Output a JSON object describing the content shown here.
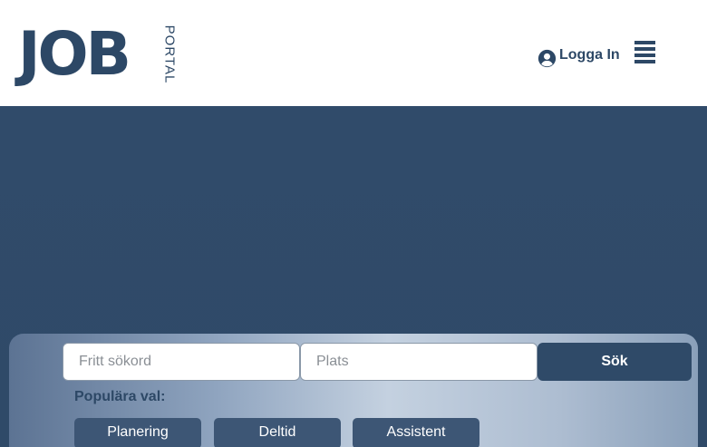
{
  "logo": {
    "main": "JOB",
    "side": "PORTAL"
  },
  "header": {
    "login_label": "Logga In",
    "login_icon": "user-circle-icon",
    "menu_icon": "hamburger-menu-icon"
  },
  "search": {
    "keyword_placeholder": "Fritt sökord",
    "location_placeholder": "Plats",
    "button_label": "Sök"
  },
  "popular": {
    "label": "Populära val:",
    "chips": [
      "Planering",
      "Deltid",
      "Assistent"
    ]
  },
  "colors": {
    "brand": "#2d4866",
    "hero": "#2f4a68",
    "chip": "#3d5675"
  }
}
